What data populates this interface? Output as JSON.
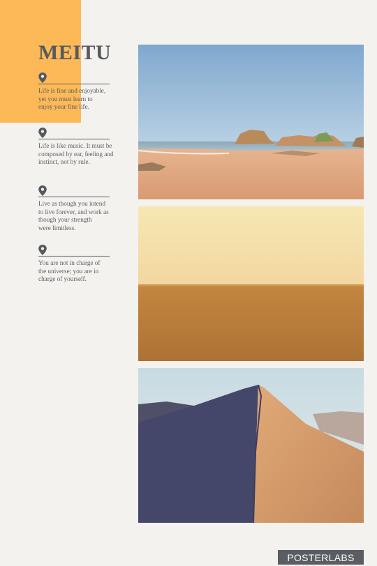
{
  "header": {
    "title": "MEITU"
  },
  "quotes": [
    {
      "icon": "location-pin-icon",
      "lines": [
        "Life is fine and enjoyable,",
        "yet you must learn to",
        "enjoy your fine life."
      ]
    },
    {
      "icon": "location-pin-icon",
      "lines": [
        "Life is like music. It must be",
        "composed by ear, feeling and",
        "instinct, not by rule."
      ]
    },
    {
      "icon": "location-pin-icon",
      "lines": [
        "Live as though you intend",
        "to live forever, and work as",
        "though your strength",
        "were limitless."
      ]
    },
    {
      "icon": "location-pin-icon",
      "lines": [
        "You are not in charge of",
        "the universe; you are in",
        "charge of yourself."
      ]
    }
  ],
  "photos": [
    {
      "subject": "rocky-beach-photo"
    },
    {
      "subject": "desert-sand-horizon-photo"
    },
    {
      "subject": "sand-dune-ridge-photo"
    }
  ],
  "footer": {
    "brand": "POSTERLABS"
  },
  "colors": {
    "accent": "#fdb958",
    "text": "#555a5e",
    "background": "#f4f2ee",
    "footer_bg": "#5a5e62"
  }
}
